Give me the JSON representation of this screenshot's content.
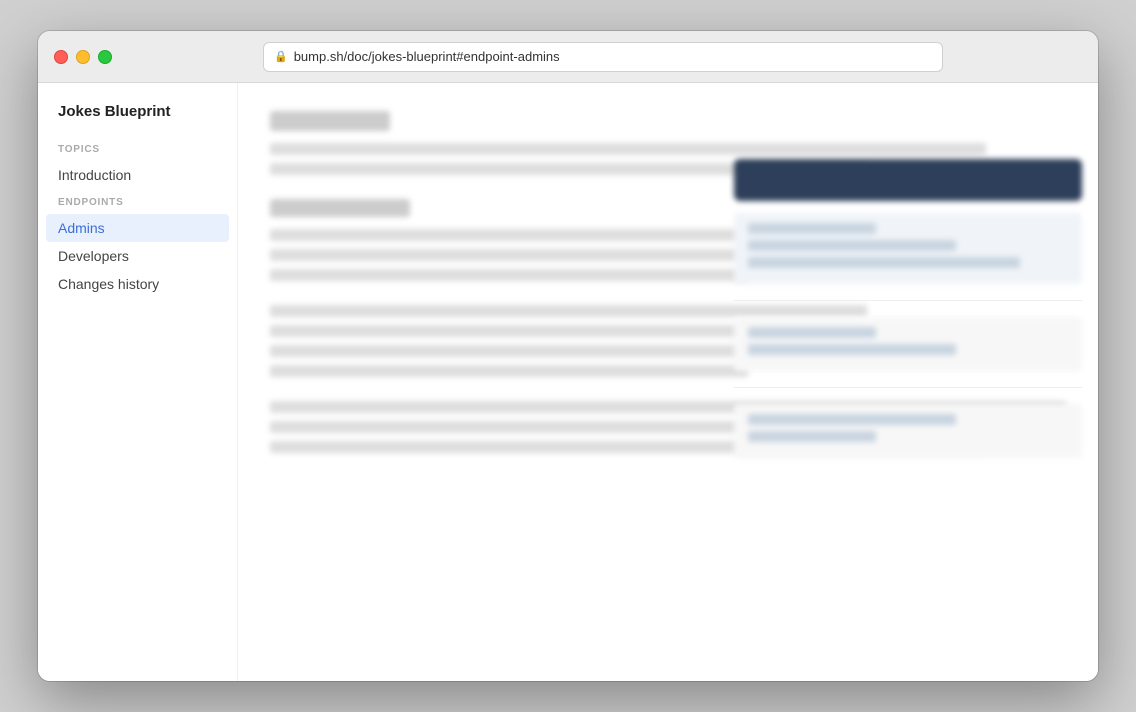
{
  "browser": {
    "url": "bump.sh/doc/jokes-blueprint#endpoint-admins",
    "lock_icon": "🔒"
  },
  "sidebar": {
    "title": "Jokes Blueprint",
    "sections": [
      {
        "label": "Topics",
        "items": [
          {
            "id": "introduction",
            "text": "Introduction",
            "active": false
          }
        ]
      },
      {
        "label": "Endpoints",
        "items": [
          {
            "id": "admins",
            "text": "Admins",
            "active": true
          },
          {
            "id": "developers",
            "text": "Developers",
            "active": false
          },
          {
            "id": "changes-history",
            "text": "Changes history",
            "active": false
          }
        ]
      }
    ]
  },
  "traffic_lights": {
    "close_label": "close",
    "minimize_label": "minimize",
    "maximize_label": "maximize"
  }
}
